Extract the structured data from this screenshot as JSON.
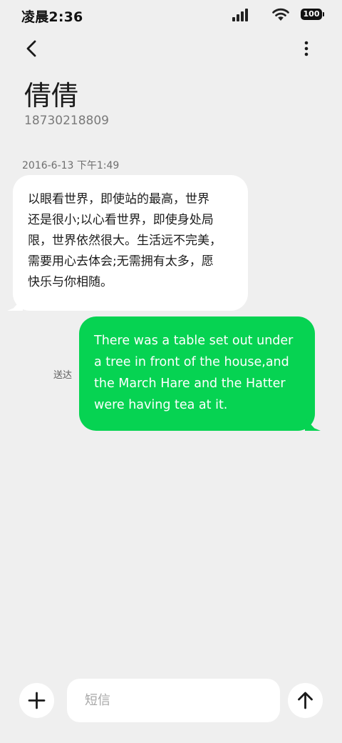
{
  "status_bar": {
    "time": "凌晨2:36",
    "battery": "100",
    "icons": [
      "signal-icon",
      "wifi-icon",
      "battery-icon"
    ]
  },
  "header": {
    "back_icon": "chevron-left-icon",
    "more_icon": "more-vertical-icon",
    "contact_name": "倩倩",
    "contact_number": "18730218809"
  },
  "conversation": {
    "timestamp": "2016-6-13 下午1:49",
    "incoming": {
      "text": "以眼看世界，即使站的最高，世界\n还是很小;以心看世界，即使身处局\n限，世界依然很大。生活远不完美，\n需要用心去体会;无需拥有太多，愿\n快乐与你相随。"
    },
    "outgoing": {
      "text": "There was a table set out under\na tree in front of the house,and\nthe March Hare and the Hatter\nwere having tea at it.",
      "status": "送达"
    }
  },
  "composer": {
    "add_icon": "plus-icon",
    "placeholder": "短信",
    "value": "",
    "send_icon": "arrow-up-icon"
  },
  "colors": {
    "background": "#efefef",
    "incoming_bubble": "#ffffff",
    "outgoing_bubble": "#06d352",
    "outgoing_text": "#ffffff"
  }
}
